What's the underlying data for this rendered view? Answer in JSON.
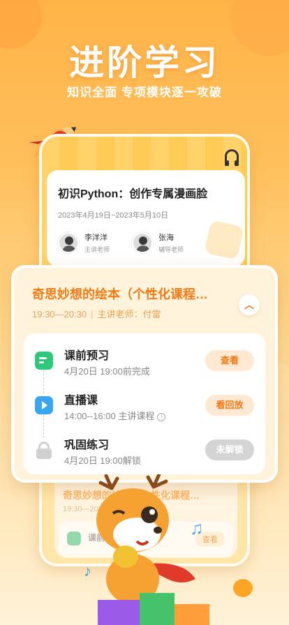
{
  "hero": {
    "title": "进阶学习",
    "subtitle": "知识全面 专项模块逐一攻破"
  },
  "course_card": {
    "title": "初识Python：创作专属漫画脸",
    "date_range": "2023年4月19日~2023年5月10日",
    "teachers": [
      {
        "name": "李洋洋",
        "role": "主讲老师"
      },
      {
        "name": "张海",
        "role": "辅导老师"
      }
    ]
  },
  "lesson_panel": {
    "title": "奇思妙想的绘本（个性化课程…",
    "time": "19:30—20:30",
    "separator": "|",
    "teacher": "主讲老师：付雷",
    "tasks": [
      {
        "name": "课前预习",
        "time": "4月20日 19:00前完成",
        "button": "查看",
        "icon": "preview-icon",
        "color": "#2fc87a"
      },
      {
        "name": "直播课",
        "time": "14:00--16:00 主讲课程",
        "button": "看回放",
        "icon": "live-tv-icon",
        "color": "#3aa6f0"
      },
      {
        "name": "巩固练习",
        "time": "4月20日 19:00解锁",
        "button": "未解锁",
        "icon": "lock-icon",
        "color": "#d0d0d0"
      }
    ]
  },
  "under_panel": {
    "title": "奇思妙想的绘本（个性化课程…",
    "time": "19:30—20:30",
    "task_name": "课前",
    "button": "查看"
  },
  "colors": {
    "accent": "#f07a14",
    "background_top": "#ffb347",
    "background_bottom": "#fff2d8"
  }
}
